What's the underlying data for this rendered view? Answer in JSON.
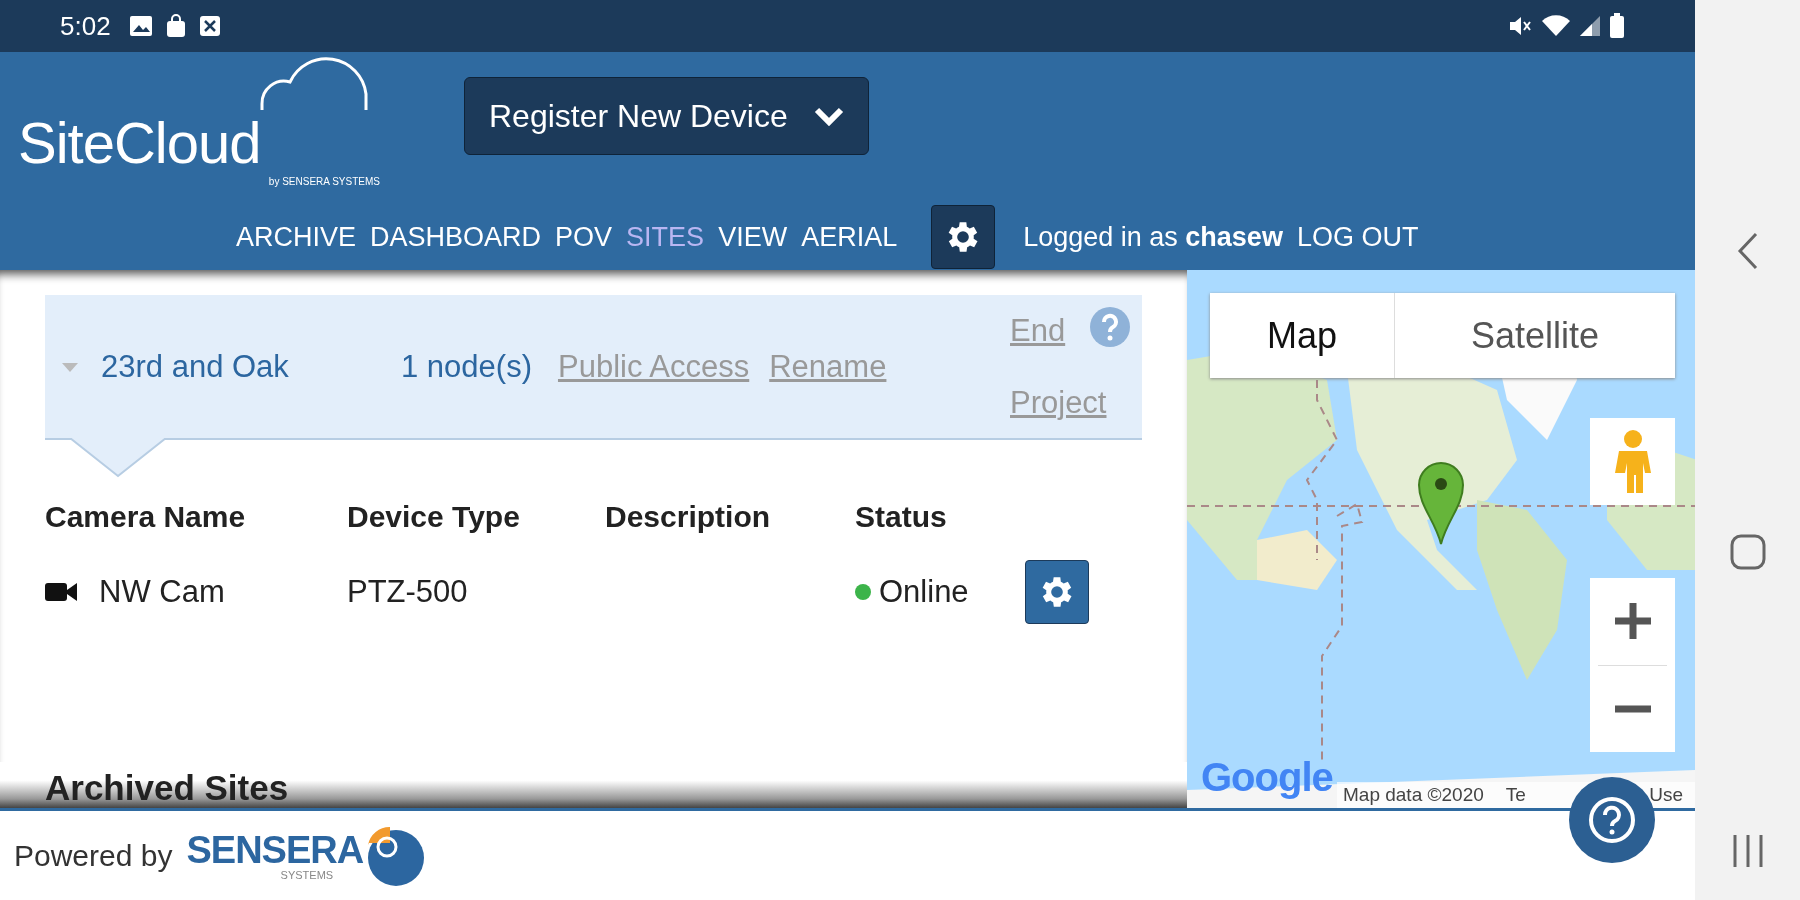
{
  "status_bar": {
    "time": "5:02"
  },
  "header": {
    "logo": {
      "name": "SiteCloud",
      "tagline": "by SENSERA SYSTEMS"
    },
    "device_dropdown": {
      "label": "Register New Device"
    },
    "nav": [
      {
        "label": "ARCHIVE",
        "selected": false
      },
      {
        "label": "DASHBOARD",
        "selected": false
      },
      {
        "label": "POV",
        "selected": false
      },
      {
        "label": "SITES",
        "selected": true
      },
      {
        "label": "VIEW",
        "selected": false
      },
      {
        "label": "AERIAL",
        "selected": false
      }
    ],
    "login": {
      "text": "Logged in as **chasew**",
      "logout": "LOG OUT"
    }
  },
  "site": {
    "name": "23rd and Oak",
    "expanded": true,
    "nodes": "1 node(s)",
    "links": [
      "Public Access",
      "Rename"
    ],
    "end_project": "End Project"
  },
  "table": {
    "columns": [
      "Camera Name",
      "Device Type",
      "Description",
      "Status"
    ],
    "rows": [
      {
        "name": "NW Cam",
        "device_type": "PTZ-500",
        "status": "Online",
        "color": "#3cb44a"
      }
    ]
  },
  "archived_sites": {
    "title": "Archived Sites"
  },
  "map": {
    "map_types": [
      {
        "label": "Map",
        "selected": true
      },
      {
        "label": "Satellite",
        "selected": false
      }
    ],
    "logo": "Google",
    "attribution": [
      "Map data ©2020",
      "Te",
      "Use"
    ]
  },
  "footer": {
    "powered_by": "Powered by",
    "brand": "SENSERA",
    "brand_sub": "SYSTEMS"
  }
}
